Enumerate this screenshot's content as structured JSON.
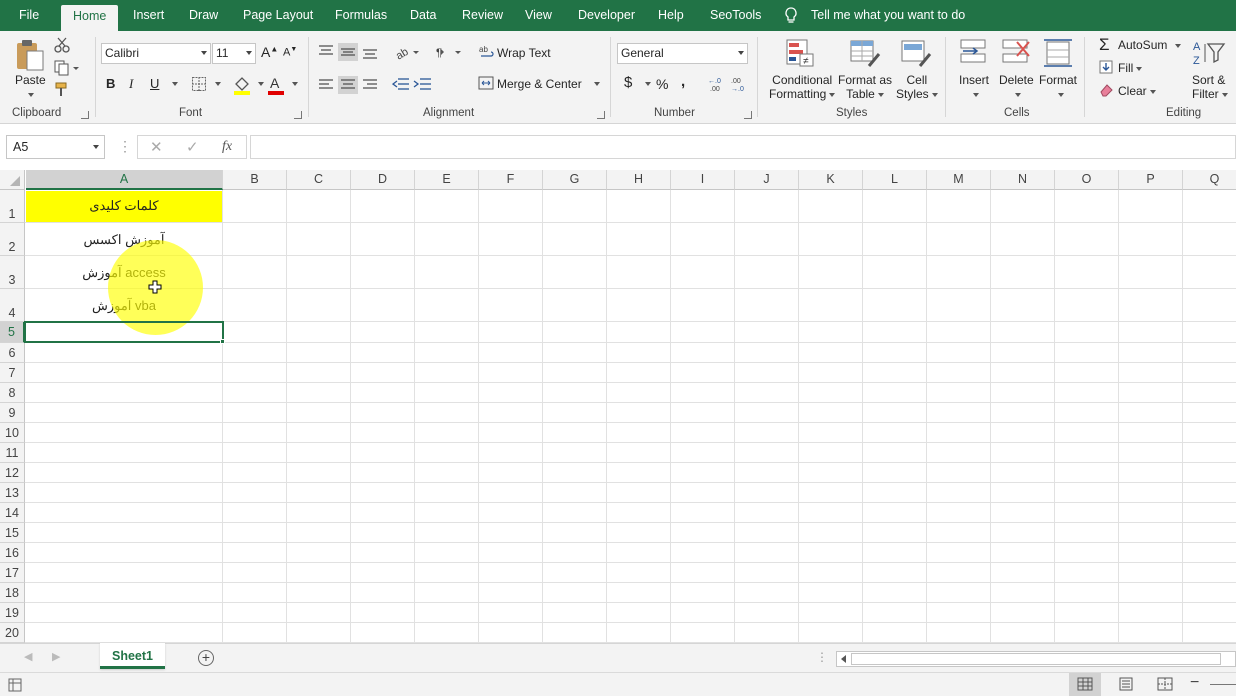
{
  "tabs": [
    "File",
    "Home",
    "Insert",
    "Draw",
    "Page Layout",
    "Formulas",
    "Data",
    "Review",
    "View",
    "Developer",
    "Help",
    "SeoTools"
  ],
  "tell_me": "Tell me what you want to do",
  "clipboard": {
    "paste": "Paste",
    "label": "Clipboard"
  },
  "font": {
    "name": "Calibri",
    "size": "11",
    "label": "Font",
    "bold": "B",
    "italic": "I",
    "underline": "U"
  },
  "alignment": {
    "wrap": "Wrap Text",
    "merge": "Merge & Center",
    "label": "Alignment"
  },
  "number": {
    "format": "General",
    "currency": "$",
    "percent": "%",
    "comma": ",",
    "label": "Number"
  },
  "styles": {
    "conditional": [
      "Conditional",
      "Formatting"
    ],
    "format_table": [
      "Format as",
      "Table"
    ],
    "cell_styles": [
      "Cell",
      "Styles"
    ],
    "label": "Styles"
  },
  "cells": {
    "insert": "Insert",
    "delete": "Delete",
    "format": "Format",
    "label": "Cells"
  },
  "editing": {
    "autosum": "AutoSum",
    "fill": "Fill",
    "clear": "Clear",
    "sort": [
      "Sort &",
      "Filter"
    ],
    "label": "Editing"
  },
  "formula_bar": {
    "name_box": "A5",
    "fx": "fx",
    "content": ""
  },
  "columns": [
    "A",
    "B",
    "C",
    "D",
    "E",
    "F",
    "G",
    "H",
    "I",
    "J",
    "K",
    "L",
    "M",
    "N",
    "O",
    "P",
    "Q"
  ],
  "rows": [
    "1",
    "2",
    "3",
    "4",
    "5",
    "6",
    "7",
    "8",
    "9",
    "10",
    "11",
    "12",
    "13",
    "14",
    "15",
    "16",
    "17",
    "18",
    "19",
    "20"
  ],
  "cells_data": {
    "A1": "کلمات کلیدی",
    "A2": "آموزش اکسس",
    "A3": "آموزش access",
    "A4": "آموزش vba"
  },
  "header_fill": "#ffff00",
  "accent": "#217346",
  "sheet_tab": "Sheet1"
}
